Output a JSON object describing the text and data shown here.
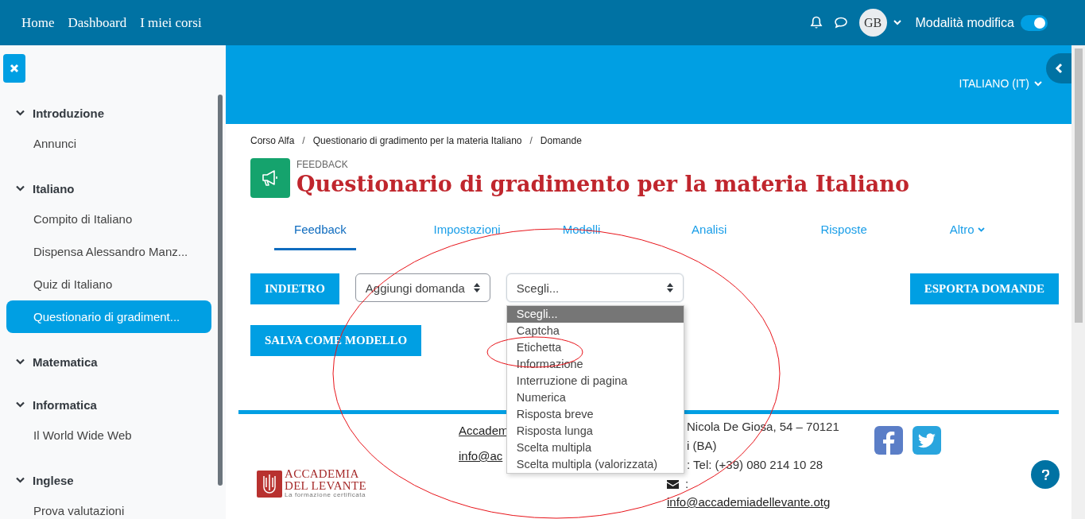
{
  "navbar": {
    "links": [
      "Home",
      "Dashboard",
      "I miei corsi"
    ],
    "avatar": "GB",
    "edit_mode": {
      "label": "Modalità modifica",
      "on": true
    }
  },
  "sidebar": {
    "sections": [
      {
        "title": "Introduzione",
        "expanded": true,
        "items": [
          {
            "label": "Annunci",
            "selected": false
          }
        ]
      },
      {
        "title": "Italiano",
        "expanded": true,
        "items": [
          {
            "label": "Compito di Italiano",
            "selected": false
          },
          {
            "label": "Dispensa Alessandro Manz...",
            "selected": false
          },
          {
            "label": "Quiz di Italiano",
            "selected": false
          },
          {
            "label": "Questionario di gradiment...",
            "selected": true
          }
        ]
      },
      {
        "title": "Matematica",
        "expanded": true
      },
      {
        "title": "Informatica",
        "expanded": true,
        "items": [
          {
            "label": "Il World Wide Web",
            "selected": false
          }
        ]
      },
      {
        "title": "Inglese",
        "expanded": true,
        "items": [
          {
            "label": "Prova valutazioni",
            "selected": false
          }
        ]
      }
    ]
  },
  "header": {
    "language": "ITALIANO (IT)"
  },
  "breadcrumb": {
    "separator": "/",
    "items": [
      "Corso Alfa",
      "Questionario di gradimento per la materia Italiano",
      "Domande"
    ]
  },
  "activity": {
    "type_label": "FEEDBACK",
    "title": "Questionario di gradimento per la materia Italiano"
  },
  "tabs": [
    {
      "label": "Feedback",
      "selected": true,
      "has_menu": false
    },
    {
      "label": "Impostazioni",
      "selected": false,
      "has_menu": false
    },
    {
      "label": "Modelli",
      "selected": false,
      "has_menu": false
    },
    {
      "label": "Analisi",
      "selected": false,
      "has_menu": false
    },
    {
      "label": "Risposte",
      "selected": false,
      "has_menu": false
    },
    {
      "label": "Altro",
      "selected": false,
      "has_menu": true
    }
  ],
  "actions": {
    "back_button": "INDIETRO",
    "add_question": "Aggiungi domanda",
    "export_button": "ESPORTA DOMANDE",
    "save_template_button": "SALVA COME MODELLO",
    "type_select": {
      "value": "Scegli...",
      "expanded": true,
      "options": [
        {
          "label": "Scegli...",
          "selected": true
        },
        {
          "label": "Captcha",
          "selected": false
        },
        {
          "label": "Etichetta",
          "selected": false
        },
        {
          "label": "Informazione",
          "selected": false
        },
        {
          "label": "Interruzione di pagina",
          "selected": false
        },
        {
          "label": "Numerica",
          "selected": false
        },
        {
          "label": "Risposta breve",
          "selected": false
        },
        {
          "label": "Risposta lunga",
          "selected": false
        },
        {
          "label": "Scelta multipla",
          "selected": false
        },
        {
          "label": "Scelta multipla (valorizzata)",
          "selected": false
        }
      ]
    }
  },
  "footer": {
    "logo": {
      "name_line_1": "ACCADEMIA",
      "name_line_2": "DEL LEVANTE",
      "tagline": "La formazione certificata"
    },
    "links": [
      "Accadem",
      "info@ac"
    ],
    "address": [
      "Nicola De Giosa, 54 – 70121",
      "i (BA)"
    ],
    "phone": ": Tel: (+39) 080 214 10 28",
    "email_label": ":",
    "email": "info@accademiadellevante.otg"
  }
}
